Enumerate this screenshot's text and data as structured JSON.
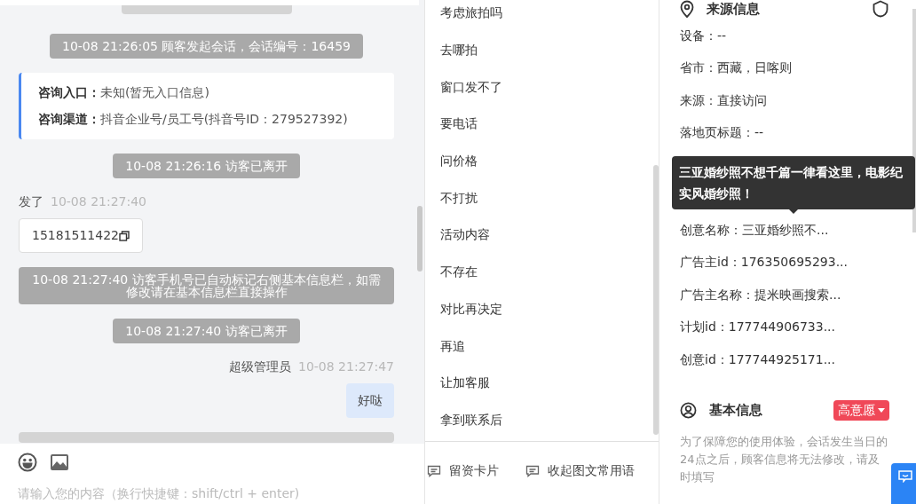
{
  "chat": {
    "messages": [
      {
        "kind": "system",
        "text": "10-08 21:26:05 顾客发起会话，会话编号：16459"
      },
      {
        "kind": "info",
        "lines": [
          {
            "label": "咨询入口：",
            "value": "未知(暂无入口信息)"
          },
          {
            "label": "咨询渠道：",
            "value": "抖音企业号/员工号(抖音号ID：279527392)"
          }
        ]
      },
      {
        "kind": "system",
        "text": "10-08 21:26:16 访客已离开"
      },
      {
        "kind": "visitor",
        "sender": "发了",
        "time": "10-08 21:27:40",
        "text": "15181511422"
      },
      {
        "kind": "system",
        "text": "10-08 21:27:40 访客手机号已自动标记右侧基本信息栏，如需修改请在基本信息栏直接操作"
      },
      {
        "kind": "system",
        "text": "10-08 21:27:40 访客已离开"
      },
      {
        "kind": "agent",
        "sender": "超级管理员",
        "time": "10-08 21:27:47",
        "text": "好哒"
      }
    ],
    "input": {
      "placeholder": "请输入您的内容（换行快捷键：shift/ctrl + enter)"
    }
  },
  "phrases": {
    "items": [
      "考虑旅拍吗",
      "去哪拍",
      "窗口发不了",
      "要电话",
      "问价格",
      "不打扰",
      "活动内容",
      "不存在",
      "对比再决定",
      "再追",
      "让加客服",
      "拿到联系后"
    ],
    "actions": [
      "留资卡片",
      "收起图文常用语"
    ]
  },
  "source_info": {
    "title": "来源信息",
    "fields": [
      {
        "text": "设备：--"
      },
      {
        "text": "省市：西藏，日喀则"
      },
      {
        "text": "来源：直接访问"
      },
      {
        "text": "落地页标题：--"
      }
    ],
    "fields_below_tooltip": [
      {
        "text": "创意名称：三亚婚纱照不..."
      },
      {
        "text": "广告主id：176350695293..."
      },
      {
        "text": "广告主名称：提米映画搜索..."
      },
      {
        "text": "计划id：177744906733..."
      },
      {
        "text": "创意id：177744925171..."
      }
    ],
    "tooltip": "三亚婚纱照不想千篇一律看这里，电影纪实风婚纱照！"
  },
  "basic_info": {
    "title": "基本信息",
    "intent_tag": "高意愿",
    "note": "为了保障您的使用体验，会话发生当日的24点之后，顾客信息将无法修改，请及时填写"
  }
}
